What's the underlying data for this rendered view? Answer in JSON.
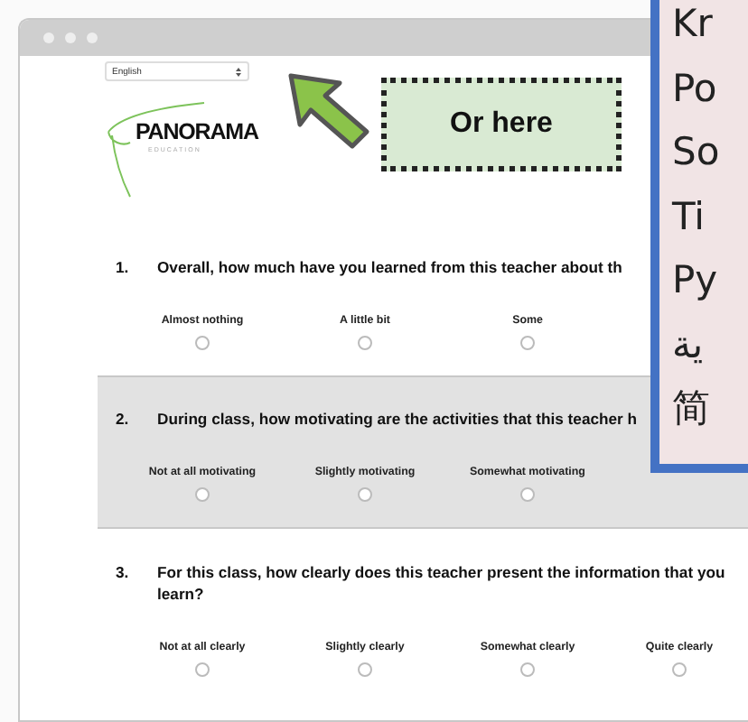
{
  "language_select": {
    "value": "English"
  },
  "logo": {
    "name": "PANORAMA",
    "tagline": "EDUCATION"
  },
  "callout": {
    "text": "Or here"
  },
  "questions": [
    {
      "number": "1.",
      "text": "Overall, how much have you learned from this teacher about th",
      "shaded": false,
      "options": [
        {
          "label": "Almost nothing",
          "selected": false
        },
        {
          "label": "A little bit",
          "selected": false
        },
        {
          "label": "Some",
          "selected": false
        }
      ]
    },
    {
      "number": "2.",
      "text": "During class, how motivating are the activities that this teacher h",
      "shaded": true,
      "options": [
        {
          "label": "Not at all motivating",
          "selected": false
        },
        {
          "label": "Slightly motivating",
          "selected": false
        },
        {
          "label": "Somewhat motivating",
          "selected": false
        }
      ]
    },
    {
      "number": "3.",
      "text": "For this class, how clearly does this teacher present the information that you\nlearn?",
      "shaded": false,
      "options": [
        {
          "label": "Not at all clearly",
          "selected": false
        },
        {
          "label": "Slightly clearly",
          "selected": false
        },
        {
          "label": "Somewhat clearly",
          "selected": false
        },
        {
          "label": "Quite clearly",
          "selected": false
        }
      ]
    }
  ],
  "language_list": [
    "Kr",
    "Po",
    "So",
    "Ti",
    "Ру",
    "ية",
    "简"
  ]
}
